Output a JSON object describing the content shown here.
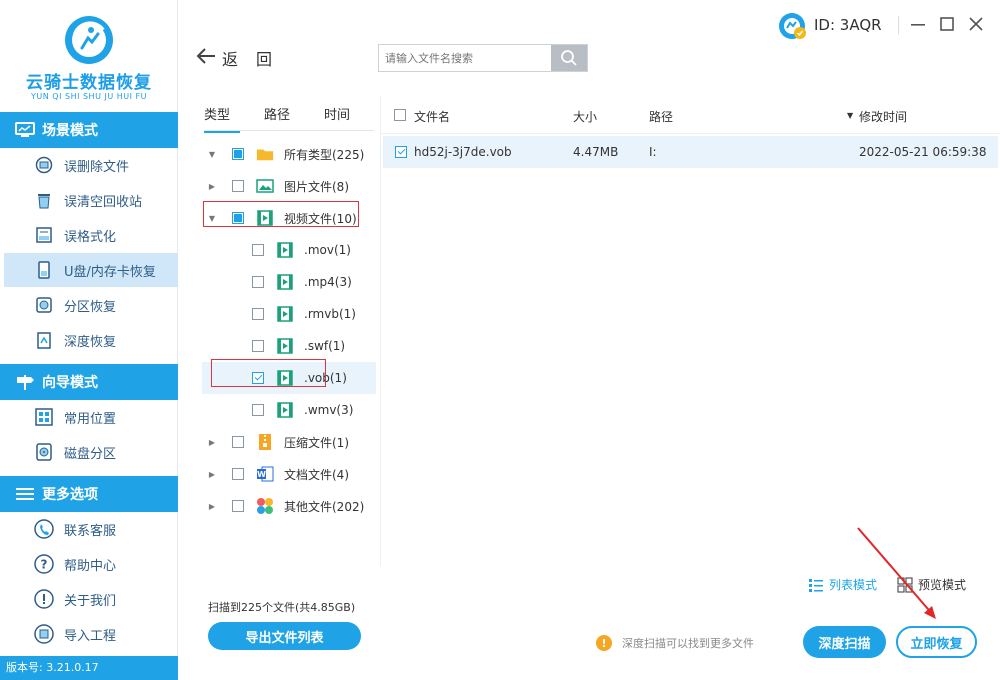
{
  "app": {
    "name": "云骑士数据恢复",
    "pinyin": "YUN QI SHI SHU JU HUI FU",
    "version": "版本号: 3.21.0.17",
    "user_id": "ID: 3AQR"
  },
  "sidebar": {
    "sections": [
      {
        "title": "场景模式",
        "icon": "monitor-icon",
        "items": [
          {
            "label": "误删除文件",
            "icon": "delete-file-icon"
          },
          {
            "label": "误清空回收站",
            "icon": "recycle-bin-icon"
          },
          {
            "label": "误格式化",
            "icon": "format-icon"
          },
          {
            "label": "U盘/内存卡恢复",
            "icon": "usb-drive-icon",
            "active": true
          },
          {
            "label": "分区恢复",
            "icon": "partition-icon"
          },
          {
            "label": "深度恢复",
            "icon": "deep-recover-icon"
          }
        ]
      },
      {
        "title": "向导模式",
        "icon": "signpost-icon",
        "items": [
          {
            "label": "常用位置",
            "icon": "windows-icon"
          },
          {
            "label": "磁盘分区",
            "icon": "disk-icon"
          }
        ]
      },
      {
        "title": "更多选项",
        "icon": "menu-icon",
        "items": [
          {
            "label": "联系客服",
            "icon": "phone-icon"
          },
          {
            "label": "帮助中心",
            "icon": "help-icon"
          },
          {
            "label": "关于我们",
            "icon": "info-icon"
          },
          {
            "label": "导入工程",
            "icon": "import-icon"
          }
        ]
      }
    ]
  },
  "toolbar": {
    "back_label": "返回",
    "search_placeholder": "请输入文件名搜索"
  },
  "tree": {
    "tabs": [
      "类型",
      "路径",
      "时间"
    ],
    "active_tab": "类型",
    "nodes": [
      {
        "label": "所有类型(225)",
        "state": "partial",
        "expand": "open",
        "icon": "folder-icon"
      },
      {
        "label": "图片文件(8)",
        "state": "off",
        "expand": "closed",
        "icon": "image-icon"
      },
      {
        "label": "视频文件(10)",
        "state": "partial",
        "expand": "open",
        "icon": "video-icon"
      },
      {
        "label": ".mov(1)",
        "state": "off",
        "expand": "none",
        "icon": "video-icon"
      },
      {
        "label": ".mp4(3)",
        "state": "off",
        "expand": "none",
        "icon": "video-icon"
      },
      {
        "label": ".rmvb(1)",
        "state": "off",
        "expand": "none",
        "icon": "video-icon"
      },
      {
        "label": ".swf(1)",
        "state": "off",
        "expand": "none",
        "icon": "video-icon"
      },
      {
        "label": ".vob(1)",
        "state": "on",
        "expand": "none",
        "icon": "video-icon",
        "selected": true
      },
      {
        "label": ".wmv(3)",
        "state": "off",
        "expand": "none",
        "icon": "video-icon"
      },
      {
        "label": "压缩文件(1)",
        "state": "off",
        "expand": "closed",
        "icon": "zip-icon"
      },
      {
        "label": "文档文件(4)",
        "state": "off",
        "expand": "closed",
        "icon": "document-icon"
      },
      {
        "label": "其他文件(202)",
        "state": "off",
        "expand": "closed",
        "icon": "other-files-icon"
      }
    ]
  },
  "file_list": {
    "columns": {
      "name": "文件名",
      "size": "大小",
      "path": "路径",
      "modified": "修改时间"
    },
    "rows": [
      {
        "name": "hd52j-3j7de.vob",
        "size": "4.47MB",
        "path": "I:",
        "modified": "2022-05-21 06:59:38",
        "checked": true
      }
    ]
  },
  "bottom": {
    "scan_summary": "扫描到225个文件(共4.85GB)",
    "export_label": "导出文件列表",
    "list_mode_label": "列表模式",
    "preview_mode_label": "预览模式",
    "tip": "深度扫描可以找到更多文件",
    "deep_scan_label": "深度扫描",
    "recover_label": "立即恢复"
  },
  "colors": {
    "accent": "#1fa3e6",
    "annotation_red": "#d9363e",
    "active_nav_bg": "#cfe7f8"
  }
}
